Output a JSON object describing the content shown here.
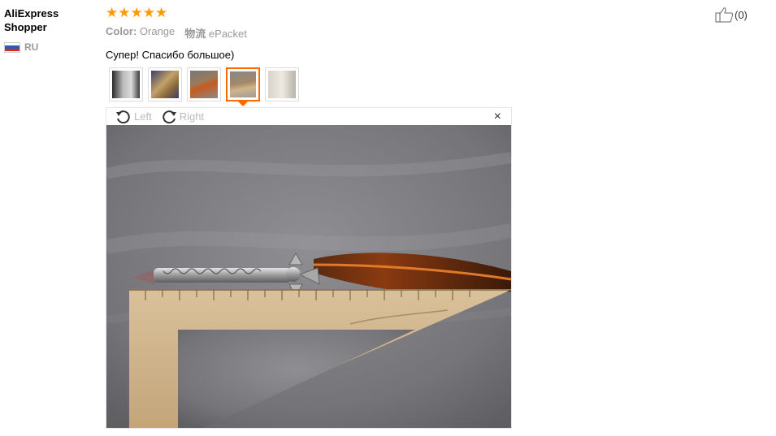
{
  "user": {
    "name_line1": "AliExpress",
    "name_line2": "Shopper",
    "country_code": "RU",
    "flag_icon": "russia-flag-icon"
  },
  "review": {
    "rating": 5,
    "color_label": "Color:",
    "color_value": "Orange",
    "shipping_label": "物流",
    "shipping_value": "ePacket",
    "text": "Супер! Спасибо большое)"
  },
  "thumbnails": [
    {
      "name": "thumbnail-1",
      "active": false
    },
    {
      "name": "thumbnail-2",
      "active": false
    },
    {
      "name": "thumbnail-3",
      "active": false
    },
    {
      "name": "thumbnail-4",
      "active": true
    },
    {
      "name": "thumbnail-5",
      "active": false
    }
  ],
  "viewer": {
    "rotate_left_label": "Left",
    "rotate_right_label": "Right",
    "close_symbol": "×"
  },
  "like": {
    "count": "(0)",
    "icon": "thumbs-up-icon"
  },
  "colors": {
    "star": "#ff9900",
    "active_border": "#ff6a00",
    "muted_text": "#999999"
  }
}
